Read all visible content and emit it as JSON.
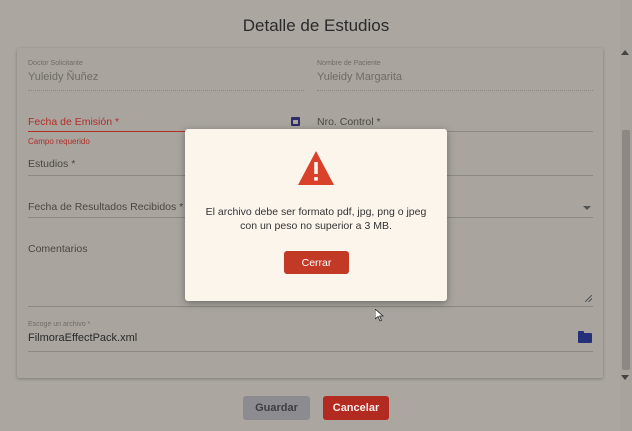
{
  "dialog": {
    "title": "Detalle de Estudios"
  },
  "form": {
    "doctor": {
      "label": "Doctor Solicitante",
      "value": "Yuleidy Ñuñez"
    },
    "patient": {
      "label": "Nombre de Paciente",
      "value": "Yuleidy Margarita"
    },
    "emission_date": {
      "label": "Fecha de Emisión *",
      "error": "Campo requerido",
      "icon": "calendar-icon"
    },
    "control_number": {
      "label": "Nro. Control *"
    },
    "studies": {
      "label": "Estudios *"
    },
    "results_date": {
      "label": "Fecha de Resultados Recibidos *"
    },
    "comments": {
      "label": "Comentarios"
    },
    "file": {
      "label": "Escoge un archivo *",
      "value": "FilmoraEffectPack.xml",
      "icon": "folder-icon"
    }
  },
  "actions": {
    "save_label": "Guardar",
    "cancel_label": "Cancelar"
  },
  "modal": {
    "icon": "warning-icon",
    "message_line1": "El archivo debe ser formato pdf, jpg, png o jpeg",
    "message_line2": "con un peso no superior a 3 MB.",
    "close_label": "Cerrar"
  },
  "colors": {
    "error": "#b03028",
    "danger_button": "#b32a20",
    "modal_background": "#fcf5ec",
    "warning": "#d9412b",
    "icon_blue": "#25307a"
  }
}
